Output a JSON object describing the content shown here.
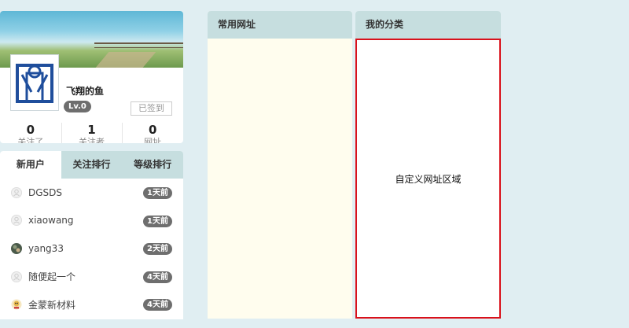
{
  "profile": {
    "username": "飞翔的鱼",
    "level": "Lv.0",
    "signin_label": "已签到",
    "stats": [
      {
        "value": "0",
        "label": "关注了"
      },
      {
        "value": "1",
        "label": "关注者"
      },
      {
        "value": "0",
        "label": "网址"
      }
    ]
  },
  "ranking": {
    "tabs": [
      "新用户",
      "关注排行",
      "等级排行"
    ],
    "users": [
      {
        "name": "DGSDS",
        "badge": "1天前",
        "icon": "default-avatar-icon"
      },
      {
        "name": "xiaowang",
        "badge": "1天前",
        "icon": "default-avatar-icon"
      },
      {
        "name": "yang33",
        "badge": "2天前",
        "icon": "photo-avatar-icon"
      },
      {
        "name": "随便起一个",
        "badge": "4天前",
        "icon": "default-avatar-icon"
      },
      {
        "name": "金蒙新材料",
        "badge": "4天前",
        "icon": "cartoon-avatar-icon"
      }
    ]
  },
  "panels": {
    "common_title": "常用网址",
    "mycat_title": "我的分类",
    "custom_area_label": "自定义网址区域"
  },
  "colors": {
    "page_bg": "#e0eef2",
    "header_bg": "#c6dedf",
    "badge_bg": "#6e6e6e",
    "highlight_border": "#d9111b",
    "common_panel_bg": "#fffdee"
  }
}
